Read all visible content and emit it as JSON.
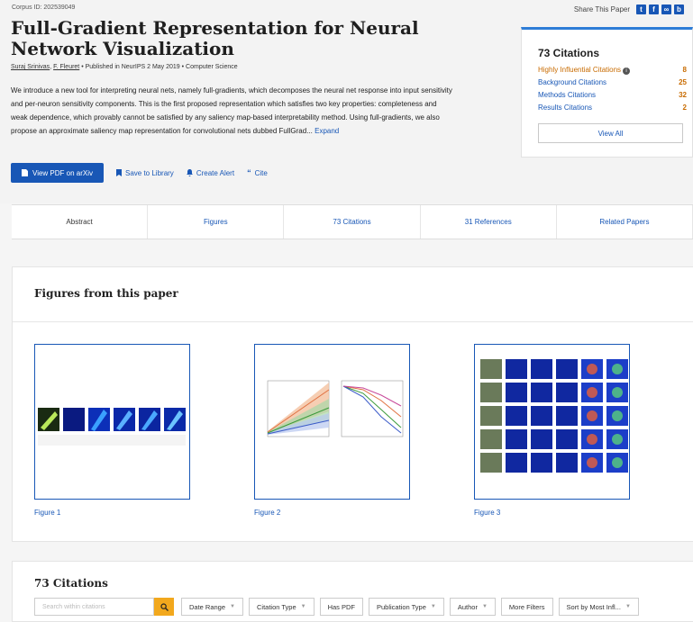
{
  "corpus": "Corpus ID: 202539049",
  "share": {
    "label": "Share This Paper",
    "icons": [
      "twitter-icon",
      "facebook-icon",
      "link-icon",
      "bibtex-icon"
    ]
  },
  "paper": {
    "title": "Full-Gradient Representation for Neural Network Visualization",
    "authors": [
      "Suraj Srinivas",
      "F. Fleuret"
    ],
    "meta_rest": "Published in NeurIPS 2 May 2019",
    "field": "Computer Science",
    "abstract": "We introduce a new tool for interpreting neural nets, namely full-gradients, which decomposes the neural net response into input sensitivity and per-neuron sensitivity components. This is the first proposed representation which satisfies two key properties: completeness and weak dependence, which provably cannot be satisfied by any saliency map-based interpretability method. Using full-gradients, we also propose an approximate saliency map representation for convolutional nets dubbed FullGrad...",
    "expand_label": "Expand"
  },
  "actions": {
    "pdf": "View PDF on arXiv",
    "library": "Save to Library",
    "alert": "Create Alert",
    "cite": "Cite"
  },
  "citations_box": {
    "count": "73 Citations",
    "rows": [
      {
        "label": "Highly Influential Citations",
        "value": "8"
      },
      {
        "label": "Background Citations",
        "value": "25"
      },
      {
        "label": "Methods Citations",
        "value": "32"
      },
      {
        "label": "Results Citations",
        "value": "2"
      }
    ],
    "view_all": "View All"
  },
  "tabs": [
    "Abstract",
    "Figures",
    "73 Citations",
    "31 References",
    "Related Papers"
  ],
  "figures": {
    "heading": "Figures from this paper",
    "items": [
      {
        "caption": "Figure 1"
      },
      {
        "caption": "Figure 2"
      },
      {
        "caption": "Figure 3"
      }
    ]
  },
  "citations_section": {
    "heading": "73 Citations",
    "search_placeholder": "Search within citations",
    "filters": [
      "Date Range",
      "Citation Type",
      "Has PDF",
      "Publication Type",
      "Author",
      "More Filters",
      "Sort by Most Infl..."
    ]
  },
  "colors": {
    "link": "#1857b6",
    "accent_orange": "#c86b00",
    "search_button": "#f2a81d"
  }
}
